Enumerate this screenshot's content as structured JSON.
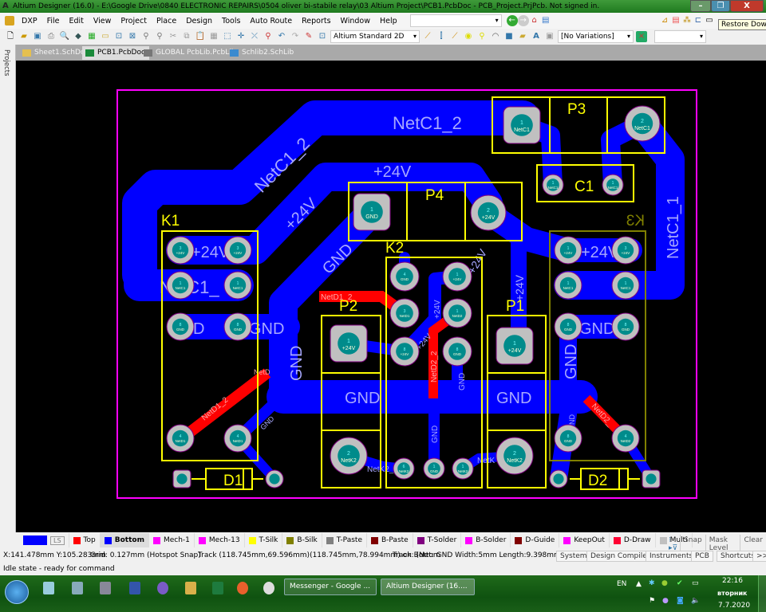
{
  "window": {
    "title": "Altium Designer (16.0) - E:\\Google Drive\\0840 ELECTRONIC REPAIRS\\0504 oliver bi-stabile relay\\03 Altium Project\\PCB1.PcbDoc - PCB_Project.PrjPcb. Not signed in.",
    "app_icon": "A",
    "minimize": "–",
    "restore": "❐",
    "close": "X",
    "tooltip": "Restore Down"
  },
  "menu": [
    "DXP",
    "File",
    "Edit",
    "View",
    "Project",
    "Place",
    "Design",
    "Tools",
    "Auto Route",
    "Reports",
    "Window",
    "Help"
  ],
  "toolbar": {
    "view_mode": "Altium Standard 2D",
    "variations": "[No Variations]",
    "extra_dropdown": "",
    "path_dropdown": ""
  },
  "sidebar": {
    "projects_label": "Projects"
  },
  "tabs": [
    {
      "label": "Sheet1.SchDoc"
    },
    {
      "label": "PCB1.PcbDoc"
    },
    {
      "label": "GLOBAL PcbLib.PcbLib"
    },
    {
      "label": "Schlib2.SchLib"
    }
  ],
  "pcb": {
    "designators": {
      "K1": "K1",
      "K2": "K2",
      "K3": "K3",
      "P1": "P1",
      "P2": "P2",
      "P3": "P3",
      "P4": "P4",
      "C1": "C1",
      "D1": "D1",
      "D2": "D2"
    },
    "net_labels": {
      "netc1_2_top": "NetC1_2",
      "netc1_2_diag": "NetC1_2",
      "p24_top": "+24V",
      "p24_diag": "+24V",
      "gnd_diag": "GND",
      "k1_24v": "+24V",
      "k1_netc1": "NetC1_",
      "k1_gnd": "GND",
      "k1_gnd2": "GND",
      "gnd_vert": "GND",
      "gnd_p2": "GND",
      "gnd_p1": "GND",
      "k3_24v": "+24V",
      "k3_gnd": "GND",
      "k3_gnd_vert": "GND",
      "netc1_1": "NetC1_1",
      "p1_24v": "+24V",
      "netd1_2_top": "NetD1_2",
      "netd1_2_diag": "NetD1_2",
      "netd1": "NetD",
      "netd2_2": "NetD2_2",
      "netd2": "NetD2_",
      "k2_24v": "+24V",
      "k2_24v_b": "+24V",
      "k2_gnd": "GND",
      "k2_gnd_bottom": "GND",
      "netk2_left": "NetK2_",
      "netk2_right": "NetK",
      "k3_gnd_small": "GND",
      "d1_gnd": "GND",
      "p4_24v": "+24V"
    },
    "pads": [
      {
        "num": "3",
        "net": "+24V"
      },
      {
        "num": "3",
        "net": "+24V"
      },
      {
        "num": "1",
        "net": "NetC1"
      },
      {
        "num": "1",
        "net": "NetC1"
      },
      {
        "num": "8",
        "net": "GND"
      },
      {
        "num": "8",
        "net": "GND"
      },
      {
        "num": "4",
        "net": "NetD1"
      },
      {
        "num": "4",
        "net": "NetD1"
      },
      {
        "num": "1",
        "net": "GND"
      },
      {
        "num": "2",
        "net": "+24V"
      },
      {
        "num": "1",
        "net": "NetC1"
      },
      {
        "num": "2",
        "net": "NetC1"
      },
      {
        "num": "1",
        "net": "NetC1"
      },
      {
        "num": "1",
        "net": "NetC1"
      },
      {
        "num": "4",
        "net": "GND"
      },
      {
        "num": "1",
        "net": "+24V"
      },
      {
        "num": "3",
        "net": "NetD1"
      },
      {
        "num": "1",
        "net": "NetD2"
      },
      {
        "num": "8",
        "net": "+24V"
      },
      {
        "num": "8",
        "net": "GND"
      },
      {
        "num": "6",
        "net": "NetK2"
      },
      {
        "num": "1",
        "net": "GND"
      },
      {
        "num": "1",
        "net": "NetK2"
      },
      {
        "num": "1",
        "net": "+24V"
      },
      {
        "num": "2",
        "net": "NetK2"
      },
      {
        "num": "1",
        "net": "+24V"
      },
      {
        "num": "2",
        "net": "NetK2"
      },
      {
        "num": "1",
        "net": "+24V"
      },
      {
        "num": "3",
        "net": "+24V"
      },
      {
        "num": "1",
        "net": "NetC1"
      },
      {
        "num": "1",
        "net": "NetC1"
      },
      {
        "num": "8",
        "net": "GND"
      },
      {
        "num": "8",
        "net": "GND"
      },
      {
        "num": "8",
        "net": "GND"
      },
      {
        "num": "4",
        "net": "NetD2"
      },
      {
        "num": "",
        "net": ""
      },
      {
        "num": "",
        "net": ""
      },
      {
        "num": "",
        "net": ""
      },
      {
        "num": "",
        "net": ""
      }
    ]
  },
  "layers": [
    {
      "label": "LS",
      "color": "#0000ff"
    },
    {
      "label": "Top",
      "color": "#ff0000"
    },
    {
      "label": "Bottom",
      "color": "#0000ff",
      "active": true
    },
    {
      "label": "Mech-1",
      "color": "#ff00ff"
    },
    {
      "label": "Mech-13",
      "color": "#ff00ff"
    },
    {
      "label": "T-Silk",
      "color": "#ffff00"
    },
    {
      "label": "B-Silk",
      "color": "#808000"
    },
    {
      "label": "T-Paste",
      "color": "#808080"
    },
    {
      "label": "B-Paste",
      "color": "#800000"
    },
    {
      "label": "T-Solder",
      "color": "#800080"
    },
    {
      "label": "B-Solder",
      "color": "#ff00ff"
    },
    {
      "label": "D-Guide",
      "color": "#800000"
    },
    {
      "label": "KeepOut",
      "color": "#ff00ff"
    },
    {
      "label": "D-Draw",
      "color": "#ff0033"
    },
    {
      "label": "Multi",
      "color": "#c0c0c0"
    }
  ],
  "layer_controls": {
    "snap": "Snap",
    "mask_level": "Mask Level",
    "clear": "Clear"
  },
  "status": {
    "coords": "X:141.478mm Y:105.283mm",
    "grid": "Grid: 0.127mm",
    "snap": "(Hotspot Snap)",
    "track": "Track (118.745mm,69.596mm)(118.745mm,78.994mm) on Bottom",
    "track_info": "Track: (Net: GND Width:5mm Length:9.398mm)",
    "state": "Idle state - ready for command"
  },
  "panels": [
    "System",
    "Design Compiler",
    "Instruments",
    "PCB",
    "Shortcuts",
    ">>"
  ],
  "taskbar": {
    "tasks": [
      "Messenger - Google ...",
      "Altium Designer (16...."
    ],
    "lang": "EN",
    "time": "22:16",
    "day": "вторник",
    "date": "7.7.2020"
  },
  "colors": {
    "board_outline": "#ff00ff",
    "bottom_copper": "#0000ff",
    "top_copper": "#ff0000",
    "silk": "#ffff00",
    "bsilk": "#808000",
    "pad": "#c0c0c0",
    "hole": "#008b8b",
    "net_label": "#a8a8ff"
  }
}
